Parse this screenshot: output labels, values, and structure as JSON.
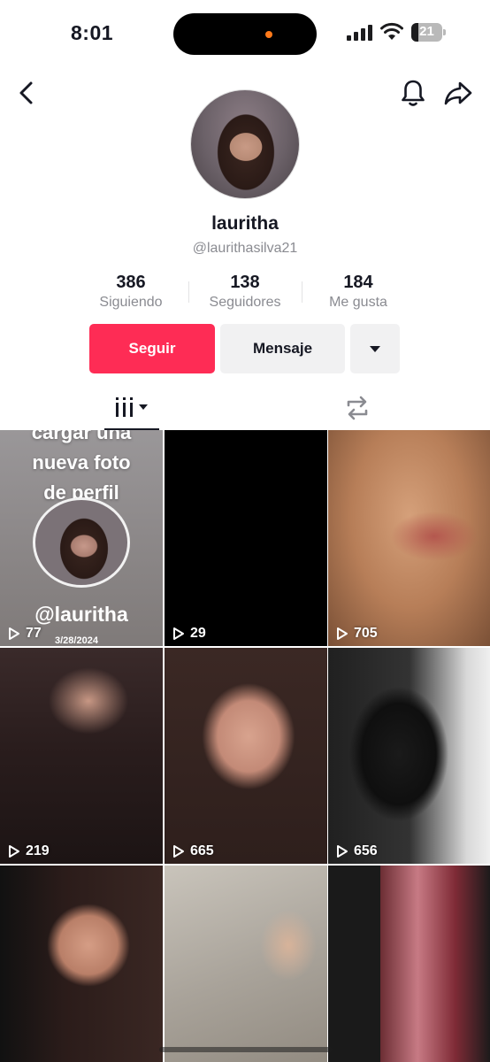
{
  "status_bar": {
    "time": "8:01",
    "battery": "21"
  },
  "profile": {
    "display_name": "lauritha",
    "handle": "@laurithasilva21",
    "stats": [
      {
        "value": "386",
        "label": "Siguiendo"
      },
      {
        "value": "138",
        "label": "Seguidores"
      },
      {
        "value": "184",
        "label": "Me gusta"
      }
    ]
  },
  "actions": {
    "follow": "Seguir",
    "message": "Mensaje"
  },
  "colors": {
    "accent": "#fe2c55",
    "secondary_button": "#f1f1f2",
    "muted_text": "#8a8b91"
  },
  "videos": [
    {
      "views": "77",
      "overlay_text": [
        "cargar una",
        "nueva foto",
        "de perfil"
      ],
      "tag": "@lauritha",
      "date": "3/28/2024"
    },
    {
      "views": "29"
    },
    {
      "views": "705"
    },
    {
      "views": "219"
    },
    {
      "views": "665"
    },
    {
      "views": "656"
    }
  ]
}
